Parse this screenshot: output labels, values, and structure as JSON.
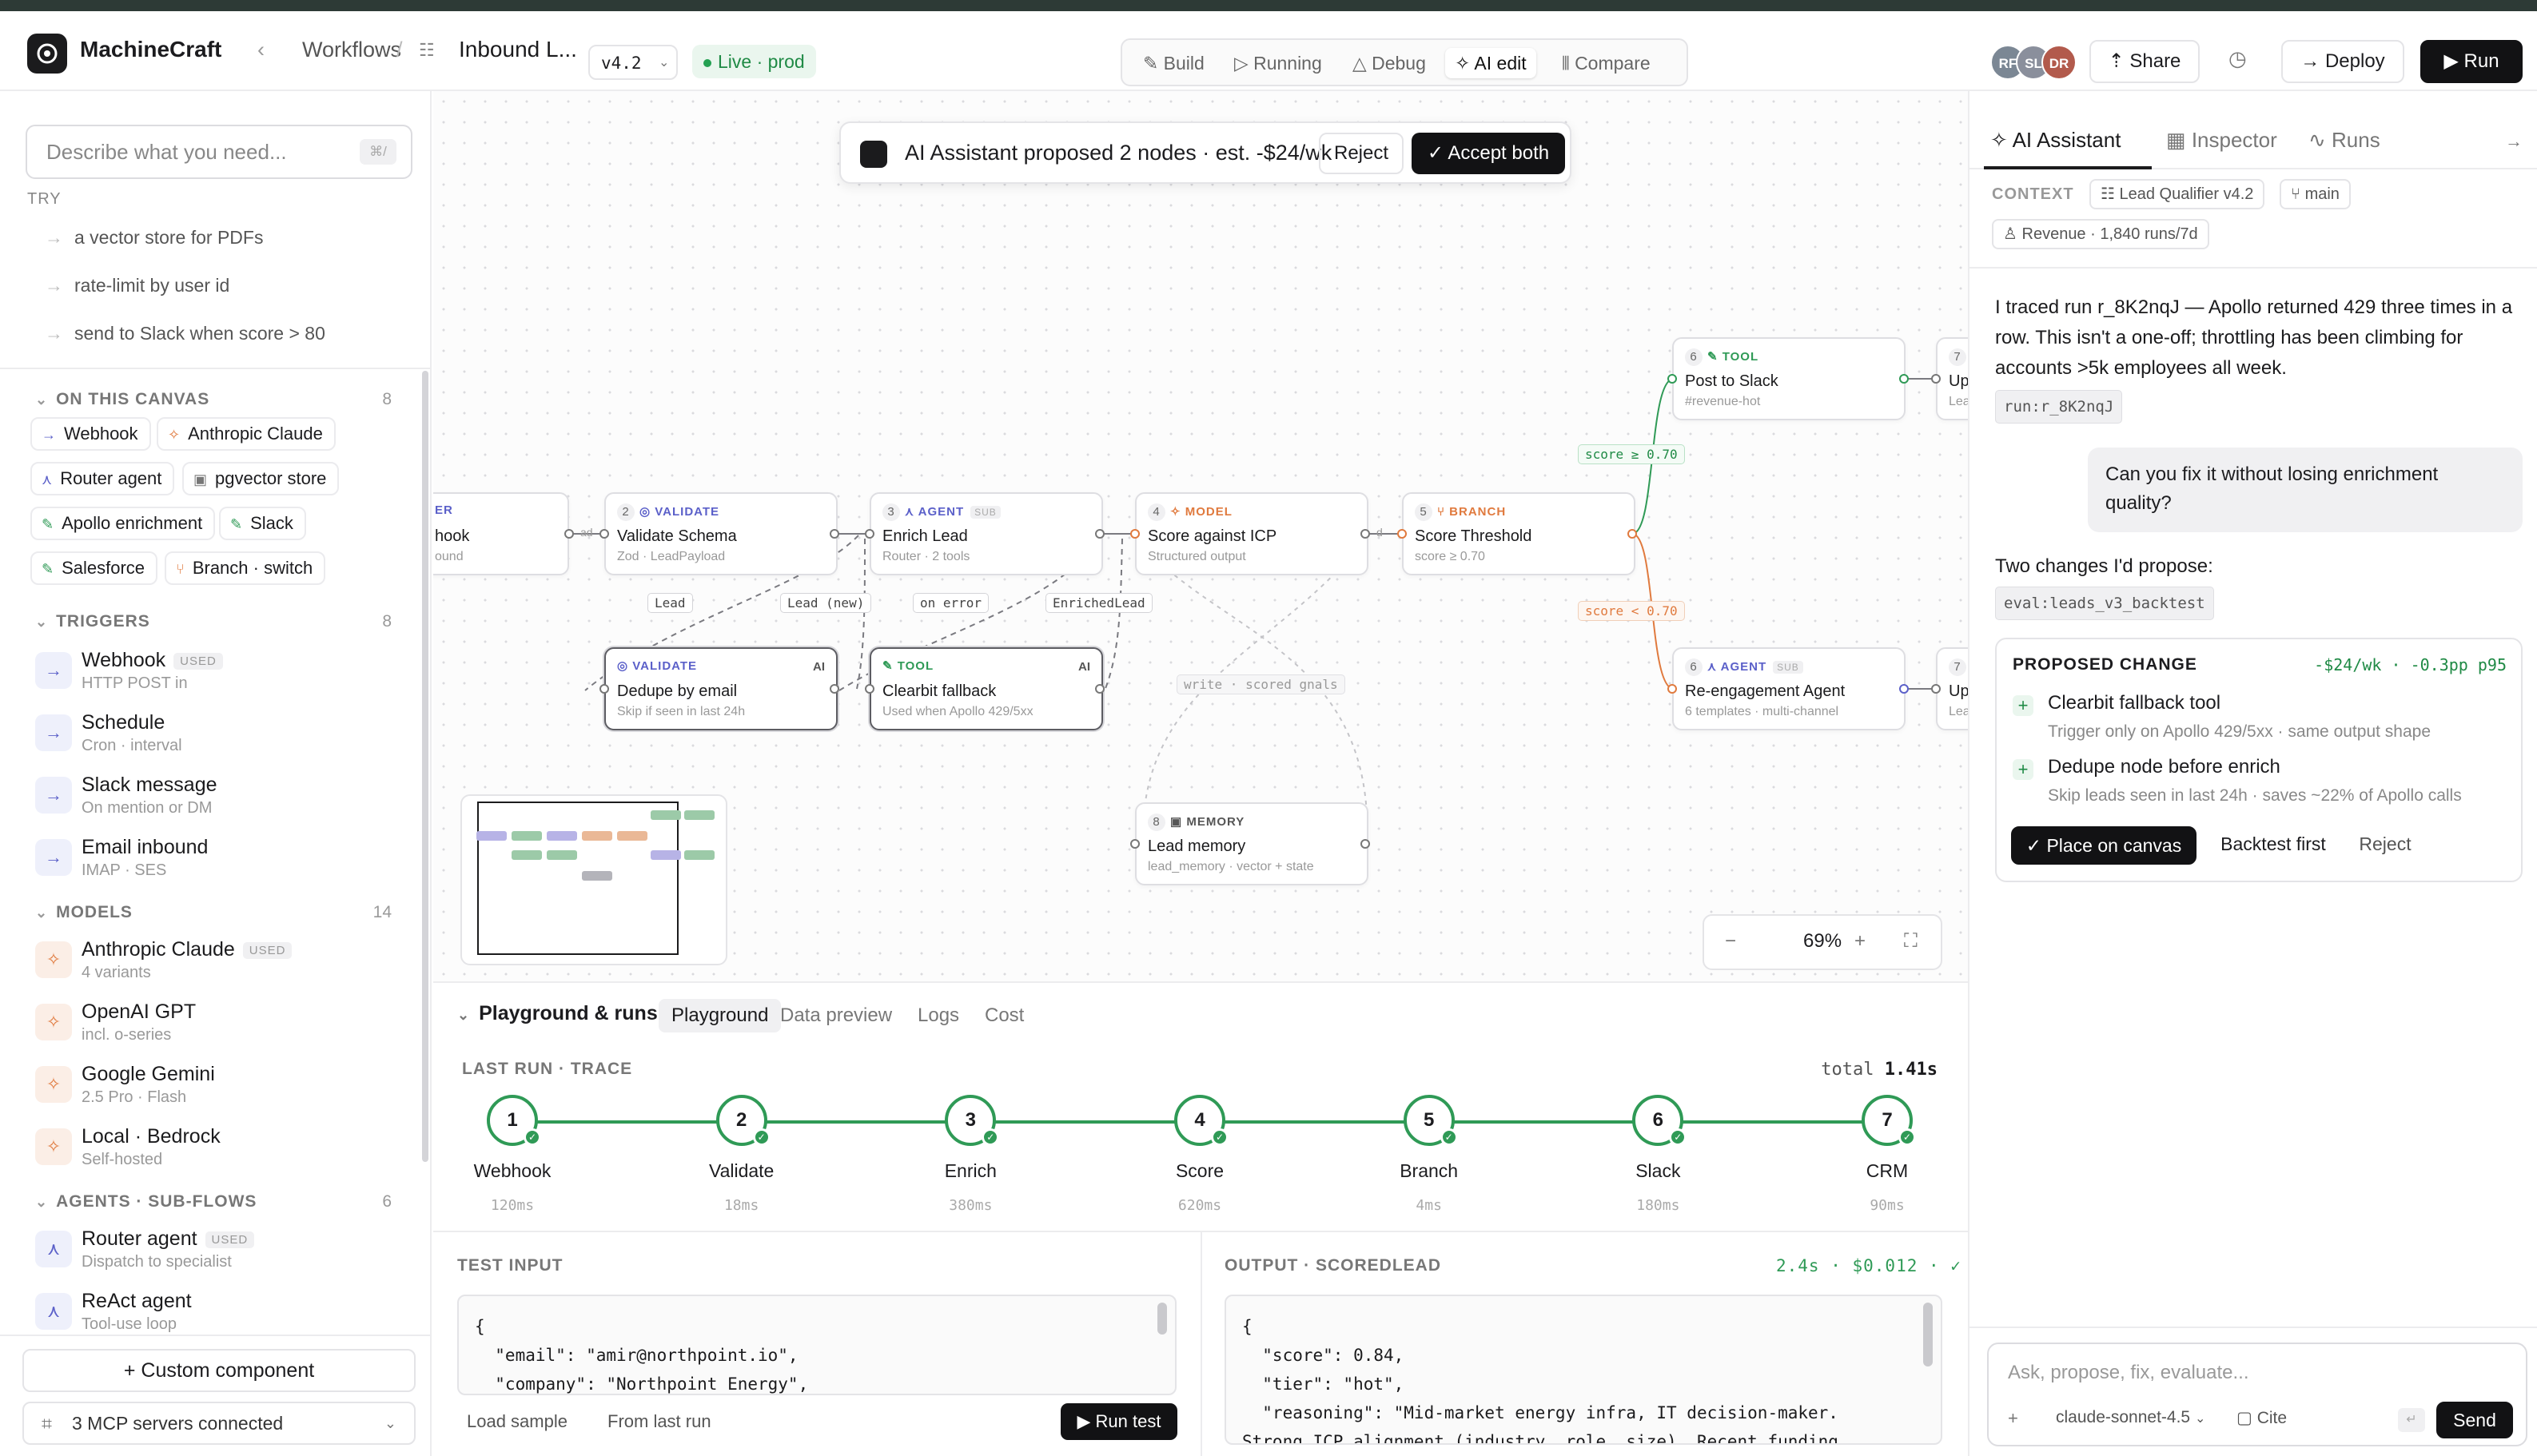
{
  "header": {
    "app_name": "MachineCraft",
    "breadcrumb_root": "Workflows",
    "breadcrumb_sep": "/",
    "workflow_name": "Inbound L...",
    "version": "v4.2",
    "status": "Live · prod",
    "modes": [
      "Build",
      "Running",
      "Debug",
      "AI edit",
      "Compare"
    ],
    "active_mode": "AI edit",
    "avatars": [
      {
        "initials": "RF",
        "color": "#7b8794"
      },
      {
        "initials": "SL",
        "color": "#8a8f9c"
      },
      {
        "initials": "DR",
        "color": "#b25a4c"
      }
    ],
    "share_label": "Share",
    "deploy_label": "Deploy",
    "run_label": "Run"
  },
  "sidebar": {
    "search_placeholder": "Describe what you need...",
    "search_shortcut": "⌘/",
    "try_label": "TRY",
    "suggestions": [
      "a vector store for PDFs",
      "rate-limit by user id",
      "send to Slack when score > 80"
    ],
    "on_canvas": {
      "title": "ON THIS CANVAS",
      "count": "8",
      "items": [
        "Webhook",
        "Anthropic Claude",
        "Router agent",
        "pgvector store",
        "Apollo enrichment",
        "Slack",
        "Salesforce",
        "Branch · switch"
      ]
    },
    "triggers": {
      "title": "TRIGGERS",
      "count": "8",
      "items": [
        {
          "name": "Webhook",
          "sub": "HTTP POST in",
          "badge": "USED"
        },
        {
          "name": "Schedule",
          "sub": "Cron · interval"
        },
        {
          "name": "Slack message",
          "sub": "On mention or DM"
        },
        {
          "name": "Email inbound",
          "sub": "IMAP · SES"
        }
      ]
    },
    "models": {
      "title": "MODELS",
      "count": "14",
      "items": [
        {
          "name": "Anthropic Claude",
          "sub": "4 variants",
          "badge": "USED"
        },
        {
          "name": "OpenAI GPT",
          "sub": "incl. o-series"
        },
        {
          "name": "Google Gemini",
          "sub": "2.5 Pro · Flash"
        },
        {
          "name": "Local · Bedrock",
          "sub": "Self-hosted"
        }
      ]
    },
    "agents": {
      "title": "AGENTS · SUB-FLOWS",
      "count": "6",
      "items": [
        {
          "name": "Router agent",
          "sub": "Dispatch to specialist",
          "badge": "USED"
        },
        {
          "name": "ReAct agent",
          "sub": "Tool-use loop"
        }
      ]
    },
    "custom_label": "Custom component",
    "mcp_label": "3 MCP servers connected"
  },
  "canvas": {
    "banner_text": "AI Assistant proposed 2 nodes · est. -$24/wk",
    "reject_label": "Reject",
    "accept_label": "Accept both",
    "nodes": {
      "webhook": {
        "title": "hook",
        "sub": "ound",
        "kind": "ER"
      },
      "validate": {
        "num": "2",
        "kind": "VALIDATE",
        "title": "Validate Schema",
        "sub": "Zod · LeadPayload"
      },
      "enrich": {
        "num": "3",
        "kind": "AGENT",
        "tag": "SUB",
        "title": "Enrich Lead",
        "sub": "Router · 2 tools"
      },
      "score": {
        "num": "4",
        "kind": "MODEL",
        "title": "Score against ICP",
        "sub": "Structured output"
      },
      "branch": {
        "num": "5",
        "kind": "BRANCH",
        "title": "Score Threshold",
        "sub": "score ≥ 0.70"
      },
      "slack": {
        "num": "6",
        "kind": "TOOL",
        "title": "Post to Slack",
        "sub": "#revenue-hot"
      },
      "slack_next": {
        "num": "7",
        "title": "Up",
        "sub": "Lea"
      },
      "reengage": {
        "num": "6",
        "kind": "AGENT",
        "tag": "SUB",
        "title": "Re-engagement Agent",
        "sub": "6 templates · multi-channel"
      },
      "reengage_next": {
        "num": "7",
        "title": "Up",
        "sub": "Lea"
      },
      "dedupe": {
        "kind": "VALIDATE",
        "ai": "AI",
        "title": "Dedupe by email",
        "sub": "Skip if seen in last 24h"
      },
      "clearbit": {
        "kind": "TOOL",
        "ai": "AI",
        "title": "Clearbit fallback",
        "sub": "Used when Apollo 429/5xx"
      },
      "memory": {
        "num": "8",
        "kind": "MEMORY",
        "title": "Lead memory",
        "sub": "lead_memory · vector + state"
      }
    },
    "edge_labels": {
      "lead": "Lead",
      "lead_new": "Lead (new)",
      "on_error": "on error",
      "enriched": "EnrichedLead",
      "write": "write · scored gnals",
      "score_hi": "score ≥ 0.70",
      "score_lo": "score < 0.70",
      "ad": "ad",
      "d": "d"
    },
    "zoom_level": "69%"
  },
  "playground": {
    "title": "Playground & runs",
    "tabs": [
      "Playground",
      "Data preview",
      "Logs",
      "Cost"
    ],
    "last_run_label": "LAST RUN · TRACE",
    "total_label": "total",
    "total_value": "1.41s",
    "steps": [
      {
        "n": "1",
        "label": "Webhook",
        "ms": "120ms"
      },
      {
        "n": "2",
        "label": "Validate",
        "ms": "18ms"
      },
      {
        "n": "3",
        "label": "Enrich",
        "ms": "380ms"
      },
      {
        "n": "4",
        "label": "Score",
        "ms": "620ms"
      },
      {
        "n": "5",
        "label": "Branch",
        "ms": "4ms"
      },
      {
        "n": "6",
        "label": "Slack",
        "ms": "180ms"
      },
      {
        "n": "7",
        "label": "CRM",
        "ms": "90ms"
      }
    ],
    "test_input_label": "TEST INPUT",
    "test_input": "{\n  \"email\": \"amir@northpoint.io\",\n  \"company\": \"Northpoint Energy\",",
    "load_sample": "Load sample",
    "from_last_run": "From last run",
    "run_test": "Run test",
    "output_label": "OUTPUT · SCOREDLEAD",
    "output_meta": "2.4s · $0.012 · ✓",
    "output": "{\n  \"score\": 0.84,\n  \"tier\": \"hot\",\n  \"reasoning\": \"Mid-market energy infra, IT decision-maker.\nStrong ICP alignment (industry, role, size). Recent funding"
  },
  "assistant": {
    "tabs": [
      "AI Assistant",
      "Inspector",
      "Runs"
    ],
    "context_label": "CONTEXT",
    "context_tags": [
      "Lead Qualifier v4.2",
      "main",
      "Revenue · 1,840 runs/7d"
    ],
    "msg1": "I traced run r_8K2nqJ — Apollo returned 429 three times in a row. This isn't a one-off; throttling has been climbing for accounts >5k employees all week.",
    "msg1_code": "run:r_8K2nqJ",
    "user_msg": "Can you fix it without losing enrichment quality?",
    "msg2": "Two changes I'd propose:",
    "msg2_code": "eval:leads_v3_backtest",
    "proposal": {
      "title": "PROPOSED CHANGE",
      "savings": "-$24/wk · -0.3pp p95",
      "items": [
        {
          "title": "Clearbit fallback tool",
          "sub": "Trigger only on Apollo 429/5xx · same output shape"
        },
        {
          "title": "Dedupe node before enrich",
          "sub": "Skip leads seen in last 24h · saves ~22% of Apollo calls"
        }
      ],
      "place_label": "Place on canvas",
      "backtest_label": "Backtest first",
      "reject_label": "Reject"
    },
    "compose_placeholder": "Ask, propose, fix, evaluate...",
    "model": "claude-sonnet-4.5",
    "cite_label": "Cite",
    "send_label": "Send"
  }
}
